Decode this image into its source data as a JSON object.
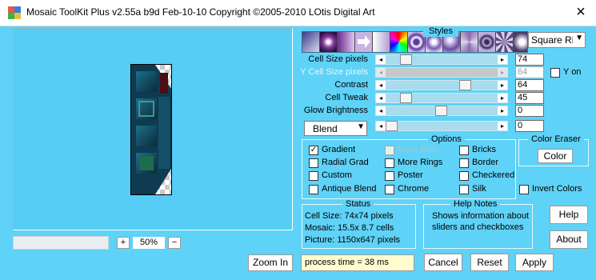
{
  "window": {
    "title": "Mosaic ToolKit Plus  v2.55a b9d Feb-10-10  Copyright ©2005-2010 LOtis Digital Art",
    "close_glyph": "×"
  },
  "zoom": {
    "plus_label": "+",
    "value": "50%",
    "minus_label": "−",
    "zoom_in_label": "Zoom In"
  },
  "styles": {
    "label": "Styles",
    "selected": "Square Rir",
    "tiles": [
      "gradient-square",
      "spark",
      "purple-fade",
      "arrow",
      "white-fade",
      "rainbow",
      "ring",
      "bubble",
      "orb",
      "swirl",
      "target",
      "gear",
      "glow",
      "wing"
    ]
  },
  "sliders": [
    {
      "label": "Cell Size pixels",
      "value": "74",
      "enabled": true,
      "level": 0.2
    },
    {
      "label": "Y Cell Size pixels",
      "value": "64",
      "enabled": false,
      "level": 0.0
    },
    {
      "label": "Contrast",
      "value": "64",
      "enabled": true,
      "level": 0.72
    },
    {
      "label": "Cell Tweak",
      "value": "45",
      "enabled": true,
      "level": 0.1
    },
    {
      "label": "Glow Brightness",
      "value": "0",
      "enabled": true,
      "level": 0.5
    },
    {
      "label": "",
      "value": "0",
      "enabled": true,
      "level": 0.0
    }
  ],
  "y_on": {
    "label": "Y on",
    "checked": false
  },
  "blend": {
    "selected": "Blend"
  },
  "options": {
    "title": "Options",
    "items": [
      {
        "label": "Gradient",
        "checked": true,
        "enabled": true
      },
      {
        "label": "Radial Grad",
        "checked": false,
        "enabled": true
      },
      {
        "label": "Custom",
        "checked": false,
        "enabled": true
      },
      {
        "label": "Antique Blend",
        "checked": false,
        "enabled": true
      },
      {
        "label": "More Balls",
        "checked": false,
        "enabled": false
      },
      {
        "label": "More Rings",
        "checked": false,
        "enabled": true
      },
      {
        "label": "Poster",
        "checked": false,
        "enabled": true
      },
      {
        "label": "Chrome",
        "checked": false,
        "enabled": true
      },
      {
        "label": "Bricks",
        "checked": false,
        "enabled": true
      },
      {
        "label": "Border",
        "checked": false,
        "enabled": true
      },
      {
        "label": "Checkered",
        "checked": false,
        "enabled": true
      },
      {
        "label": "Silk",
        "checked": false,
        "enabled": true
      },
      {
        "label": "Invert Colors",
        "checked": false,
        "enabled": true
      }
    ]
  },
  "color_eraser": {
    "title": "Color Eraser",
    "button_label": "Color"
  },
  "status": {
    "title": "Status",
    "lines": [
      "Cell Size: 74x74 pixels",
      "Mosaic:  15.5x  8.7 cells",
      "Picture: 1150x647 pixels"
    ]
  },
  "help_notes": {
    "title": "Help Notes",
    "lines": [
      "Shows information about",
      "sliders and checkboxes"
    ]
  },
  "buttons": {
    "help": "Help",
    "about": "About",
    "cancel": "Cancel",
    "reset": "Reset",
    "apply": "Apply"
  },
  "process_time": "process time = 38 ms",
  "colors": {
    "background": "#5fd2f7",
    "preview_bg": "#55cdf5",
    "slider_track": "#a8dcee",
    "process_bg": "#fffcd0"
  }
}
